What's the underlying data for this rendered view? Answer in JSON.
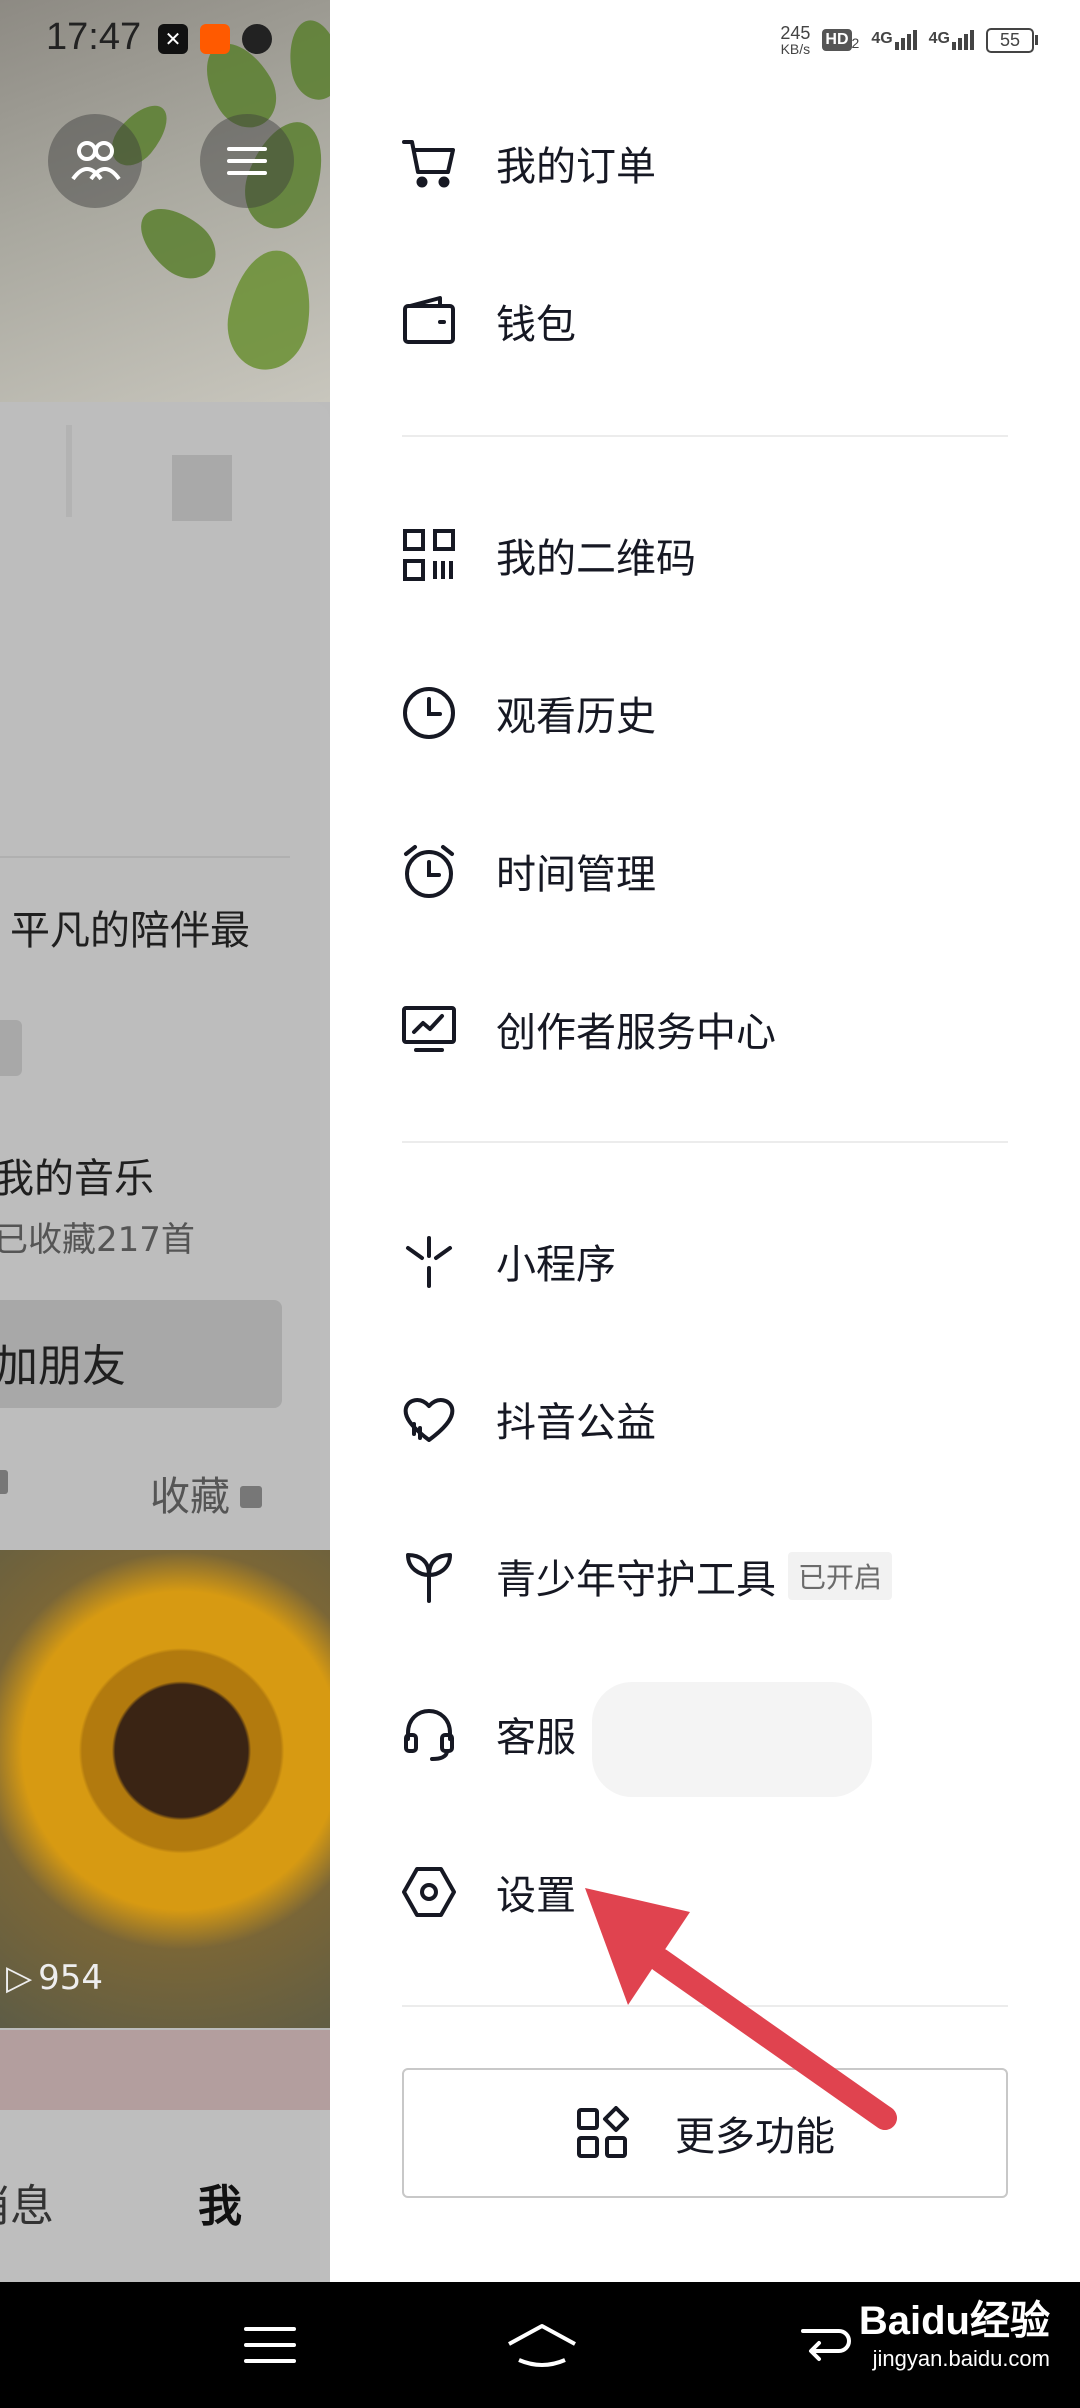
{
  "status_bar": {
    "time": "17:47",
    "net_speed_value": "245",
    "net_speed_unit": "KB/s",
    "hd_label": "HD",
    "hd_sub": "2",
    "sim1_label": "4G",
    "sim2_label": "4G",
    "battery": "55"
  },
  "background_profile": {
    "text_partial_1": "平凡的陪伴最",
    "text_partial_2": "我的音乐",
    "text_partial_3": "已收藏217首",
    "add_friend_partial": "加朋友",
    "tab_collect": "收藏",
    "view_count": "954",
    "nav_messages_partial": "消息",
    "nav_me": "我"
  },
  "drawer": {
    "items": [
      {
        "label": "我的订单",
        "icon": "cart-icon"
      },
      {
        "label": "钱包",
        "icon": "wallet-icon"
      },
      {
        "label": "我的二维码",
        "icon": "qr-code-icon"
      },
      {
        "label": "观看历史",
        "icon": "clock-icon"
      },
      {
        "label": "时间管理",
        "icon": "alarm-clock-icon"
      },
      {
        "label": "创作者服务中心",
        "icon": "creator-monitor-icon"
      },
      {
        "label": "小程序",
        "icon": "mini-program-icon"
      },
      {
        "label": "抖音公益",
        "icon": "charity-heart-icon"
      },
      {
        "label": "青少年守护工具",
        "icon": "sprout-icon",
        "badge": "已开启"
      },
      {
        "label": "客服",
        "icon": "headset-icon"
      },
      {
        "label": "设置",
        "icon": "settings-hexagon-icon"
      }
    ],
    "more_button": "更多功能"
  },
  "watermark": {
    "brand": "Baidu经验",
    "url": "jingyan.baidu.com"
  },
  "colors": {
    "annotation_arrow": "#e0434f",
    "drawer_bg": "#ffffff",
    "text_primary": "#161823"
  }
}
